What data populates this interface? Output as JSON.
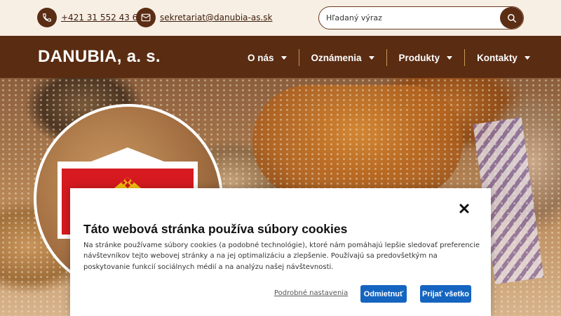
{
  "topbar": {
    "phone": "+421 31 552 43 62",
    "email": "sekretariat@danubia-as.sk",
    "search_placeholder": "Hľadaný výraz"
  },
  "nav": {
    "brand": "DANUBIA, a. s.",
    "items": [
      {
        "label": "O nás"
      },
      {
        "label": "Oznámenia"
      },
      {
        "label": "Produkty"
      },
      {
        "label": "Kontakty"
      }
    ]
  },
  "cookie": {
    "title": "Táto webová stránka používa súbory cookies",
    "body": "Na stránke používame súbory cookies (a podobné technológie), ktoré nám pomáhajú lepšie sledovať preferencie návštevníkov tejto webovej stránky a na jej optimalizáciu a zlepšenie. Používajú sa predovšetkým na poskytovanie funkcií sociálnych médií a na analýzu našej návštevnosti.",
    "settings_link": "Podrobné nastavenia",
    "deny_label": "Odmietnuť",
    "accept_label": "Prijať všetko"
  },
  "colors": {
    "brand_brown": "#5a2c12",
    "accent_gold": "#c79a54",
    "button_blue": "#1565c0"
  },
  "icons": {
    "phone": "phone-icon",
    "email": "envelope-icon",
    "search": "search-icon",
    "close": "close-icon",
    "dropdown": "chevron-down-icon"
  }
}
